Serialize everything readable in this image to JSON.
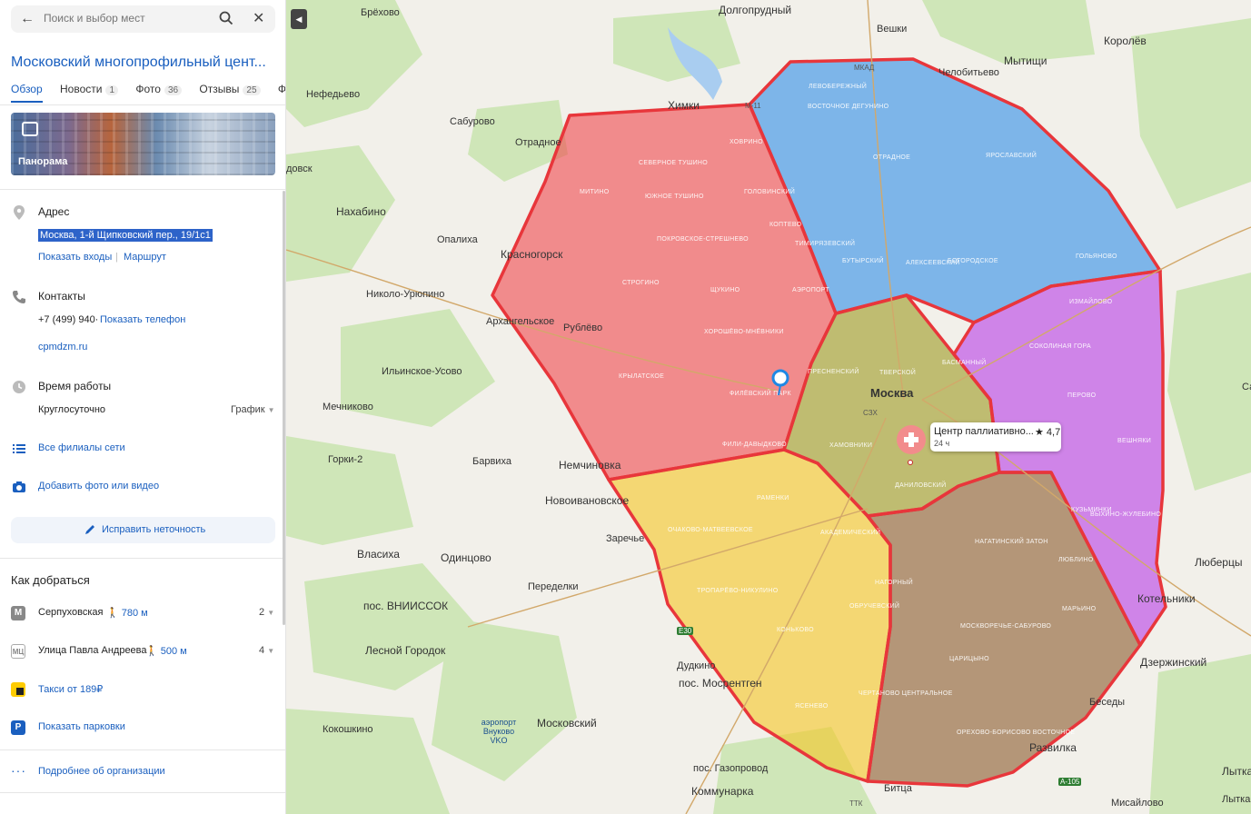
{
  "search": {
    "placeholder": "Поиск и выбор мест"
  },
  "org": {
    "title": "Московский многопрофильный цент...",
    "tabs": [
      {
        "label": "Обзор"
      },
      {
        "label": "Новости",
        "count": "1"
      },
      {
        "label": "Фото",
        "count": "36"
      },
      {
        "label": "Отзывы",
        "count": "25"
      },
      {
        "label": "Филиа"
      }
    ],
    "panorama_label": "Панорама",
    "address": {
      "heading": "Адрес",
      "value": "Москва, 1-й Щипковский пер., 19/1с1",
      "entrances_link": "Показать входы",
      "separator": "|",
      "route_link": "Маршрут"
    },
    "contacts": {
      "heading": "Контакты",
      "phone": "+7 (499) 940·",
      "show_phone": "Показать телефон",
      "website": "cpmdzm.ru"
    },
    "hours": {
      "heading": "Время работы",
      "value": "Круглосуточно",
      "schedule": "График"
    },
    "branches_link": "Все филиалы сети",
    "add_media_link": "Добавить фото или видео",
    "fix_button": "Исправить неточность",
    "directions": {
      "heading": "Как добраться",
      "items": [
        {
          "badge": "M",
          "name": "Серпуховская",
          "walk": "780 м",
          "num": "2"
        },
        {
          "badge": "МЦ",
          "name": "Улица Павла Андреева",
          "walk": "500 м",
          "num": "4"
        }
      ],
      "taxi": "Такси от 189₽",
      "parking": "Показать парковки"
    },
    "more_link": "Подробнее об организации"
  },
  "map": {
    "places": [
      {
        "t": "Брёхово"
      },
      {
        "t": "Долгопрудный"
      },
      {
        "t": "Вешки"
      },
      {
        "t": "Королёв"
      },
      {
        "t": "Челобитьево"
      },
      {
        "t": "Мытищи"
      },
      {
        "t": "Нефедьево"
      },
      {
        "t": "Химки"
      },
      {
        "t": "Сабурово"
      },
      {
        "t": "Отрадное"
      },
      {
        "t": "довск"
      },
      {
        "t": "Нахабино"
      },
      {
        "t": "Опалиха"
      },
      {
        "t": "Красногорск"
      },
      {
        "t": "Николо-Урюпино"
      },
      {
        "t": "Архангельское"
      },
      {
        "t": "Рублёво"
      },
      {
        "t": "Ильинское-Усово"
      },
      {
        "t": "Мечниково"
      },
      {
        "t": "Москва"
      },
      {
        "t": "Горки-2"
      },
      {
        "t": "Барвиха"
      },
      {
        "t": "Немчиновка"
      },
      {
        "t": "Новоивановское"
      },
      {
        "t": "Заречье"
      },
      {
        "t": "Власиха"
      },
      {
        "t": "Одинцово"
      },
      {
        "t": "пос. ВНИИССОК"
      },
      {
        "t": "Переделки"
      },
      {
        "t": "Лесной Городок"
      },
      {
        "t": "Дудкино"
      },
      {
        "t": "пос. Мосрентген"
      },
      {
        "t": "Кокошкино"
      },
      {
        "t": "Московский"
      },
      {
        "t": "аэропорт Внуково VKO"
      },
      {
        "t": "пос. Газопровод"
      },
      {
        "t": "Коммунарка"
      },
      {
        "t": "Битца"
      },
      {
        "t": "Развилка"
      },
      {
        "t": "Беседы"
      },
      {
        "t": "Дзержинский"
      },
      {
        "t": "Котельники"
      },
      {
        "t": "Люберцы"
      },
      {
        "t": "Лыткарино"
      },
      {
        "t": "Мисайлово"
      },
      {
        "t": "Лыткарин"
      },
      {
        "t": "Са"
      }
    ],
    "districts": [
      "СЕВЕРНОЕ ТУШИНО",
      "ЮЖНОЕ ТУШИНО",
      "ПОКРОВСКОЕ-СТРЕШНЕВО",
      "МИТИНО",
      "СТРОГИНО",
      "ЩУКИНО",
      "ХОРОШЁВО-МНЁВНИКИ",
      "КРЫЛАТСКОЕ",
      "ФИЛЁВСКИЙ ПАРК",
      "ФИЛИ-ДАВЫДКОВО",
      "ХОВРИНО",
      "ГОЛОВИНСКИЙ",
      "КОПТЕВО",
      "ТИМИРЯЗЕВСКИЙ",
      "АЭРОПОРТ",
      "ЛЕВОБЕРЕЖНЫЙ",
      "ВОСТОЧНОЕ ДЕГУНИНО",
      "ОТРАДНОЕ",
      "БУТЫРСКИЙ",
      "АЛЕКСЕЕВСКИЙ",
      "БОГОРОДСКОЕ",
      "ЯРОСЛАВСКИЙ",
      "ГОЛЬЯНОВО",
      "ИЗМАЙЛОВО",
      "СОКОЛИНАЯ ГОРА",
      "ПЕРОВО",
      "ВЕШНЯКИ",
      "КУЗЬМИНКИ",
      "ВЫХИНО-ЖУЛЕБИНО",
      "БАСМАННЫЙ",
      "ТВЕРСКОЙ",
      "ПРЕСНЕНСКИЙ",
      "ХАМОВНИКИ",
      "ДАНИЛОВСКИЙ",
      "РАМЕНКИ",
      "ОЧАКОВО-МАТВЕЕВСКОЕ",
      "АКАДЕМИЧЕСКИЙ",
      "ТРОПАРЁВО-НИКУЛИНО",
      "ОБРУЧЕВСКИЙ",
      "КОНЬКОВО",
      "ЯСЕНЕВО",
      "ЧЕРТАНОВО ЦЕНТРАЛЬНОЕ",
      "НАГОРНЫЙ",
      "НАГАТИНСКИЙ ЗАТОН",
      "МОСКВОРЕЧЬЕ-САБУРОВО",
      "ЦАРИЦЫНО",
      "ОРЕХОВО-БОРИСОВО ВОСТОЧНОЕ",
      "МАРЬИНО",
      "ЛЮБЛИНО"
    ],
    "roads": [
      "МКАД",
      "ТТК",
      "СЗХ",
      "М-11",
      "E30",
      "А-105"
    ],
    "poi_card": {
      "title": "Центр паллиативно...",
      "rating": "★ 4,7",
      "hours": "24 ч"
    },
    "zones": [
      {
        "name": "west",
        "color": "#f0474d"
      },
      {
        "name": "north",
        "color": "#2f8ee8"
      },
      {
        "name": "center",
        "color": "#9c9a1f"
      },
      {
        "name": "east",
        "color": "#b83ce6"
      },
      {
        "name": "southwest",
        "color": "#f5c623"
      },
      {
        "name": "south",
        "color": "#8b5a2b"
      }
    ],
    "border_color": "#e8363b"
  }
}
